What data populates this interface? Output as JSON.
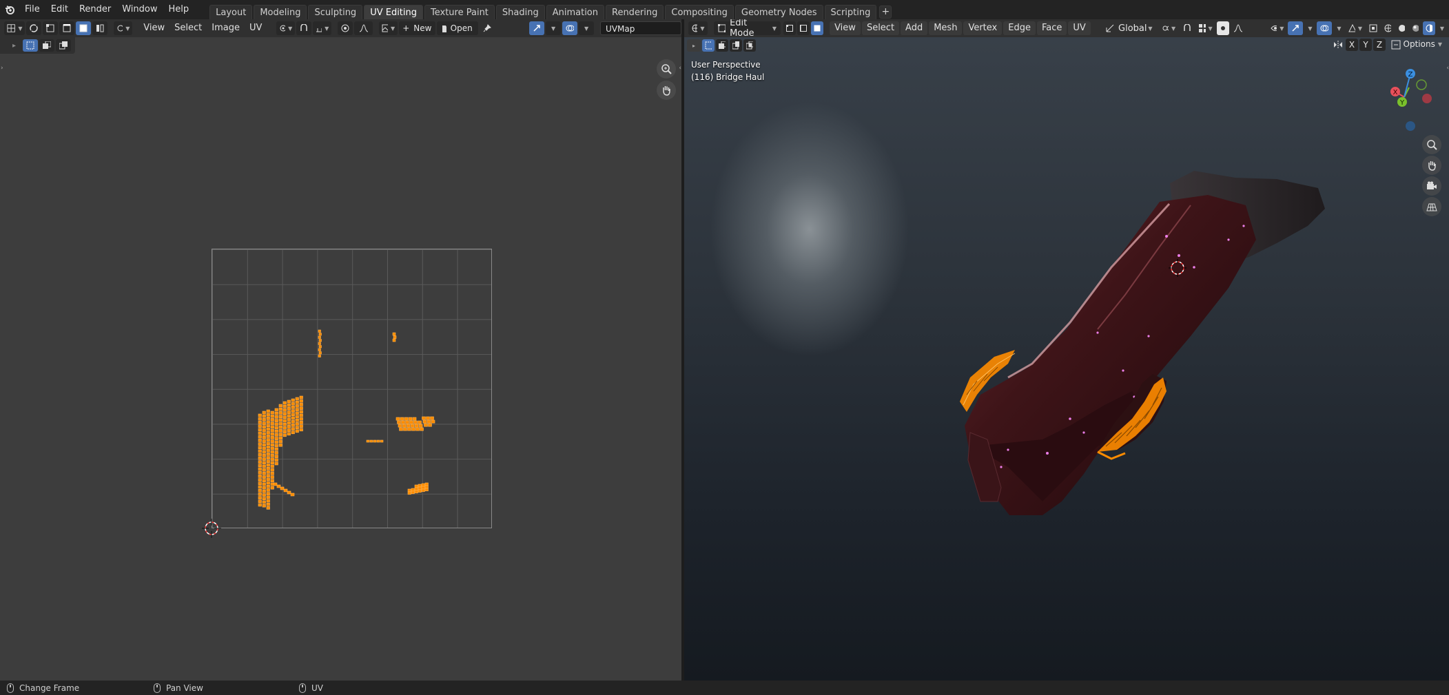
{
  "app": {
    "logo_icon": "blender-logo-icon"
  },
  "topbar": {
    "menus": [
      "File",
      "Edit",
      "Render",
      "Window",
      "Help"
    ],
    "workspaces": [
      {
        "label": "Layout",
        "active": false
      },
      {
        "label": "Modeling",
        "active": false
      },
      {
        "label": "Sculpting",
        "active": false
      },
      {
        "label": "UV Editing",
        "active": true
      },
      {
        "label": "Texture Paint",
        "active": false
      },
      {
        "label": "Shading",
        "active": false
      },
      {
        "label": "Animation",
        "active": false
      },
      {
        "label": "Rendering",
        "active": false
      },
      {
        "label": "Compositing",
        "active": false
      },
      {
        "label": "Geometry Nodes",
        "active": false
      },
      {
        "label": "Scripting",
        "active": false
      }
    ],
    "add_workspace": "+"
  },
  "uv_editor": {
    "menus": [
      "View",
      "Select",
      "Image",
      "UV"
    ],
    "new_label": "New",
    "open_label": "Open",
    "uvmap_value": "UVMap",
    "island_color": "#ff8c00",
    "background_color": "#3d3d3d"
  },
  "viewport": {
    "mode_label": "Edit Mode",
    "menus": [
      "View",
      "Select",
      "Add",
      "Mesh",
      "Vertex",
      "Edge",
      "Face",
      "UV"
    ],
    "transform_orientation": "Global",
    "options_label": "Options",
    "axis_buttons": [
      "X",
      "Y",
      "Z"
    ],
    "overlay_line1": "User Perspective",
    "overlay_line2": "(116) Bridge Haul",
    "gizmo_axes": {
      "x": "X",
      "y": "Y",
      "z": "Z"
    },
    "axis_colors": {
      "x": "#e8505b",
      "y": "#7ac02c",
      "z": "#3b8fe0"
    }
  },
  "statusbar": {
    "items": [
      {
        "icon": "mouse-left-icon",
        "label": "Change Frame"
      },
      {
        "icon": "mouse-middle-icon",
        "label": "Pan View"
      },
      {
        "icon": "mouse-right-icon",
        "label": "UV"
      }
    ]
  }
}
